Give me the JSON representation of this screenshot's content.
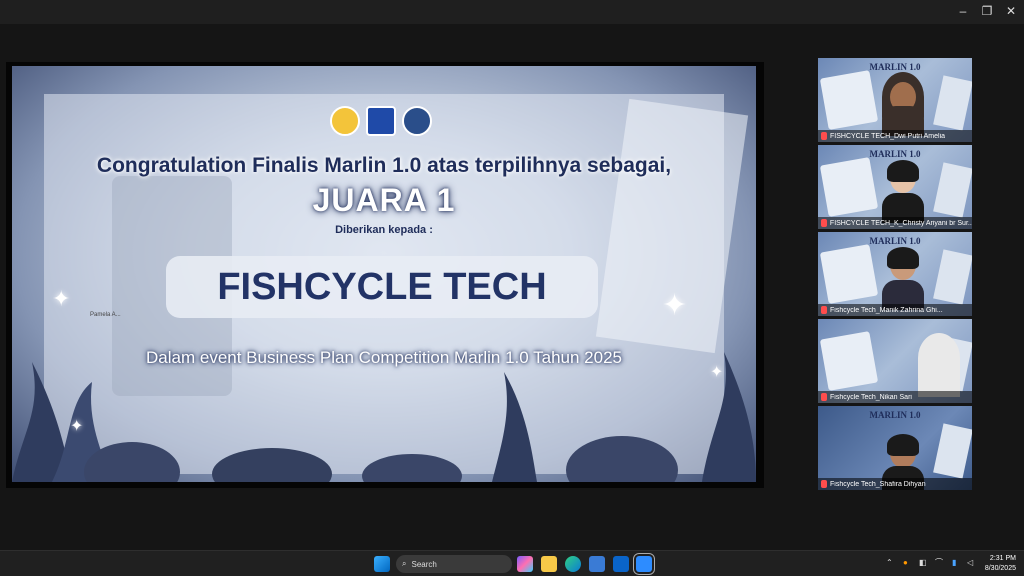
{
  "window": {
    "minimize": "–",
    "restore": "❐",
    "close": "✕"
  },
  "slide": {
    "headline": "Congratulation Finalis Marlin 1.0 atas terpilihnya sebagai,",
    "award": "JUARA 1",
    "given_to": "Diberikan kepada :",
    "team": "FISHCYCLE TECH",
    "event": "Dalam event Business Plan Competition Marlin 1.0 Tahun 2025",
    "small_tag": "Pamela A...",
    "logo_colors": [
      "#f3c43a",
      "#1f4aa8",
      "#2a4e8a"
    ]
  },
  "participants": [
    {
      "name": "FISHCYCLE TECH_Dwi Putri Amelia",
      "brand": "MARLIN 1.0"
    },
    {
      "name": "FISHCYCLE TECH_K_Christy Ariyani br Sur...",
      "brand": "MARLIN 1.0"
    },
    {
      "name": "Fishcycle Tech_Manik Zahrina Ghi...",
      "brand": "MARLIN 1.0"
    },
    {
      "name": "Fishcycle Tech_Nikan Sari",
      "brand": ""
    },
    {
      "name": "Fishcycle Tech_Shafira Dihyan",
      "brand": "MARLIN 1.0"
    }
  ],
  "taskbar": {
    "search_label": "Search",
    "time": "2:31 PM",
    "date": "8/30/2025"
  },
  "colors": {
    "accent": "#223366",
    "mic_muted": "#ff4d4d"
  }
}
